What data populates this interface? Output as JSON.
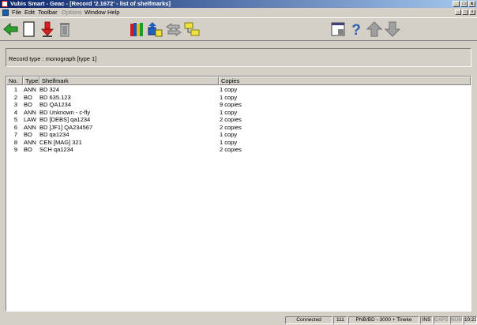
{
  "window": {
    "title": "Vubis Smart - Geac - [Record '2.1672' - list of shelfmarks]"
  },
  "window_controls": {
    "minimize": "_",
    "maximize": "□",
    "close": "x"
  },
  "menu": {
    "items": [
      {
        "label": "File",
        "enabled": true
      },
      {
        "label": "Edit",
        "enabled": true
      },
      {
        "label": "Toolbar",
        "enabled": true
      },
      {
        "label": "Options",
        "enabled": false
      },
      {
        "label": "Window",
        "enabled": true
      },
      {
        "label": "Help",
        "enabled": true
      }
    ]
  },
  "toolbar": {
    "buttons": [
      "back-arrow-icon",
      "new-record-icon",
      "download-icon",
      "delete-icon",
      "books-icon",
      "move-items-icon",
      "transfer-icon",
      "folders-icon",
      "display-window-icon",
      "help-icon",
      "up-arrow-icon",
      "down-arrow-icon"
    ]
  },
  "record_type": {
    "label": "Record type : monograph [type 1]"
  },
  "table": {
    "columns": [
      "No.",
      "Type",
      "Shelfmark",
      "Copies"
    ],
    "rows": [
      {
        "no": "1",
        "type": "ANN",
        "shelfmark": "BD 324",
        "copies": "1 copy"
      },
      {
        "no": "2",
        "type": "BO",
        "shelfmark": "BD 635.123",
        "copies": "1 copy"
      },
      {
        "no": "3",
        "type": "BO",
        "shelfmark": "BD QA1234",
        "copies": "9 copies"
      },
      {
        "no": "4",
        "type": "ANN",
        "shelfmark": "BD Unknown - c-fly",
        "copies": "1 copy"
      },
      {
        "no": "5",
        "type": "LAW",
        "shelfmark": "BD [DEBS] qa1234",
        "copies": "2 copies"
      },
      {
        "no": "6",
        "type": "ANN",
        "shelfmark": "BD [JF1] QA234567",
        "copies": "2 copies"
      },
      {
        "no": "7",
        "type": "BO",
        "shelfmark": "BD qa1234",
        "copies": "1 copy"
      },
      {
        "no": "8",
        "type": "ANN",
        "shelfmark": "CEN [MAG] 321",
        "copies": "1 copy"
      },
      {
        "no": "9",
        "type": "BO",
        "shelfmark": "SCH qa1234",
        "copies": "2 copies"
      }
    ]
  },
  "statusbar": {
    "connection": "Connected",
    "session": "111",
    "location": "PNB/BD - 3000 + Tineke",
    "ins": "INS",
    "caps": "CAPS",
    "num": "NUM",
    "time": "10:23"
  }
}
